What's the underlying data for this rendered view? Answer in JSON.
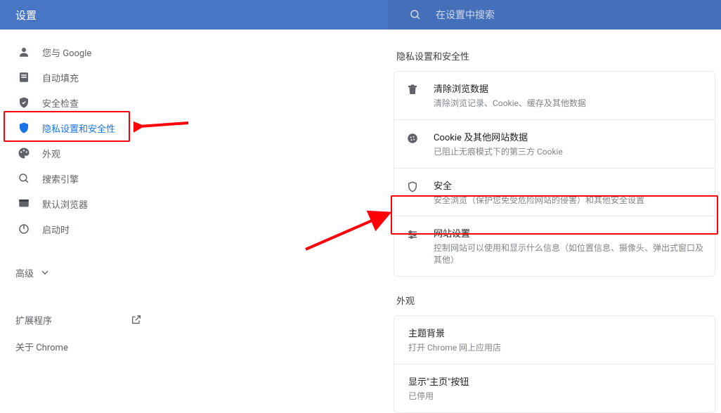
{
  "header": {
    "title": "设置",
    "search_placeholder": "在设置中搜索"
  },
  "sidebar": {
    "items": [
      {
        "label": "您与 Google"
      },
      {
        "label": "自动填充"
      },
      {
        "label": "安全检查"
      },
      {
        "label": "隐私设置和安全性"
      },
      {
        "label": "外观"
      },
      {
        "label": "搜索引擎"
      },
      {
        "label": "默认浏览器"
      },
      {
        "label": "启动时"
      }
    ],
    "advanced": "高级",
    "extensions": "扩展程序",
    "about": "关于 Chrome"
  },
  "main": {
    "privacy_title": "隐私设置和安全性",
    "privacy_rows": [
      {
        "title": "清除浏览数据",
        "desc": "清除浏览记录、Cookie、缓存及其他数据"
      },
      {
        "title": "Cookie 及其他网站数据",
        "desc": "已阻止无痕模式下的第三方 Cookie"
      },
      {
        "title": "安全",
        "desc": "安全浏览（保护您免受危险网站的侵害）和其他安全设置"
      },
      {
        "title": "网站设置",
        "desc": "控制网站可以使用和显示什么信息（如位置信息、摄像头、弹出式窗口及其他）"
      }
    ],
    "appearance_title": "外观",
    "appearance_rows": [
      {
        "title": "主题背景",
        "desc": "打开 Chrome 网上应用店"
      },
      {
        "title": "显示\"主页\"按钮",
        "desc": "已停用"
      }
    ]
  }
}
